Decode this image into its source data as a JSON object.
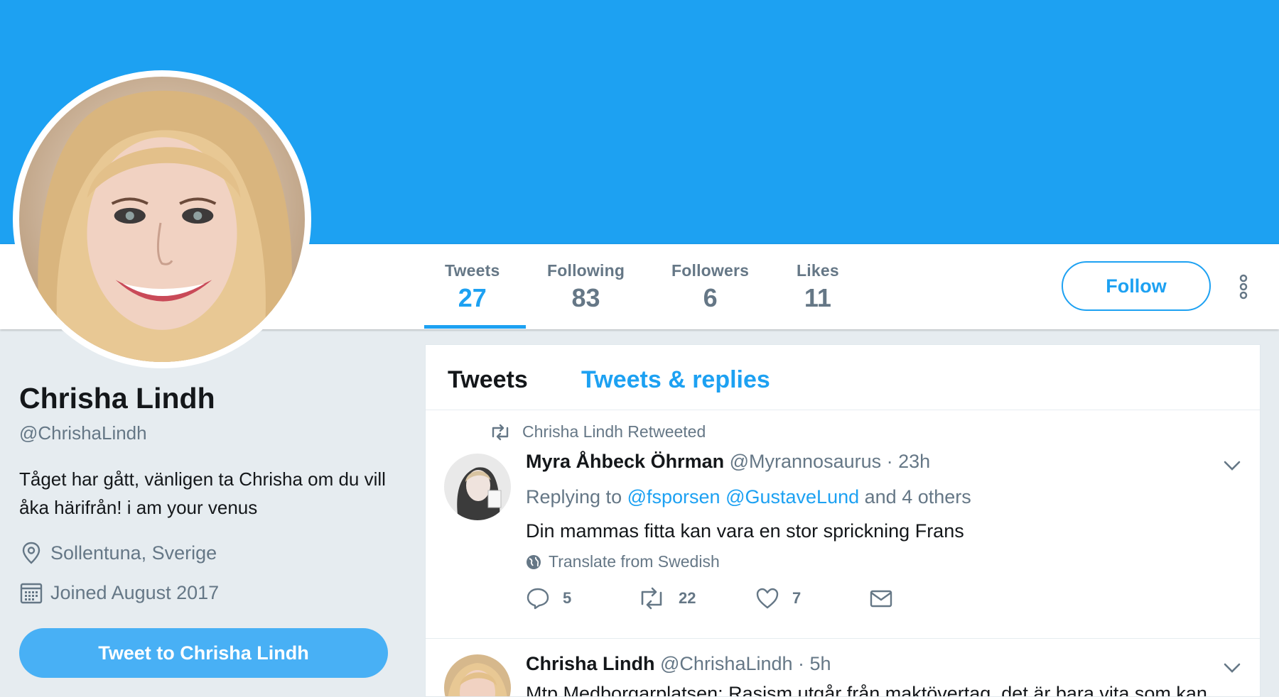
{
  "colors": {
    "brand": "#1da1f2",
    "banner": "#1da1f2",
    "text_primary": "#14171a",
    "text_secondary": "#657786",
    "page_background": "#e6ecf0"
  },
  "profile_nav": {
    "stats": [
      {
        "label": "Tweets",
        "value": "27",
        "active": true
      },
      {
        "label": "Following",
        "value": "83"
      },
      {
        "label": "Followers",
        "value": "6"
      },
      {
        "label": "Likes",
        "value": "11"
      }
    ],
    "follow_label": "Follow",
    "more_icon": "vertical-dots-icon"
  },
  "profile": {
    "name": "Chrisha Lindh",
    "handle": "@ChrishaLindh",
    "bio": "Tåget har gått, vänligen ta Chrisha om du vill åka härifrån! i am your venus",
    "location": "Sollentuna, Sverige",
    "location_icon": "location-pin-icon",
    "joined": "Joined August 2017",
    "joined_icon": "calendar-icon",
    "tweet_to_label": "Tweet to Chrisha Lindh"
  },
  "timeline": {
    "tabs": [
      {
        "label": "Tweets",
        "active": true
      },
      {
        "label": "Tweets & replies"
      }
    ],
    "tweets": [
      {
        "context": "Chrisha Lindh Retweeted",
        "context_icon": "retweet-icon",
        "author_name": "Myra Åhbeck Öhrman",
        "author_handle": "@Myrannosaurus",
        "time": "· 23h",
        "replying_prefix": "Replying to",
        "replying_mentions": [
          "@fsporsen",
          "@GustaveLund"
        ],
        "replying_suffix": "and 4 others",
        "text": "Din mammas fitta kan vara en stor sprickning Frans",
        "translate": "Translate from Swedish",
        "translate_icon": "globe-icon",
        "actions": {
          "replies": "5",
          "retweets": "22",
          "likes": "7"
        },
        "action_icons": [
          "reply-icon",
          "retweet-icon",
          "heart-icon",
          "envelope-icon"
        ]
      },
      {
        "author_name": "Chrisha Lindh",
        "author_handle": "@ChrishaLindh",
        "time": "· 5h",
        "text": "Mtp Medborgarplatsen: Rasism utgår från maktövertag, det är bara vita som kan"
      }
    ]
  }
}
